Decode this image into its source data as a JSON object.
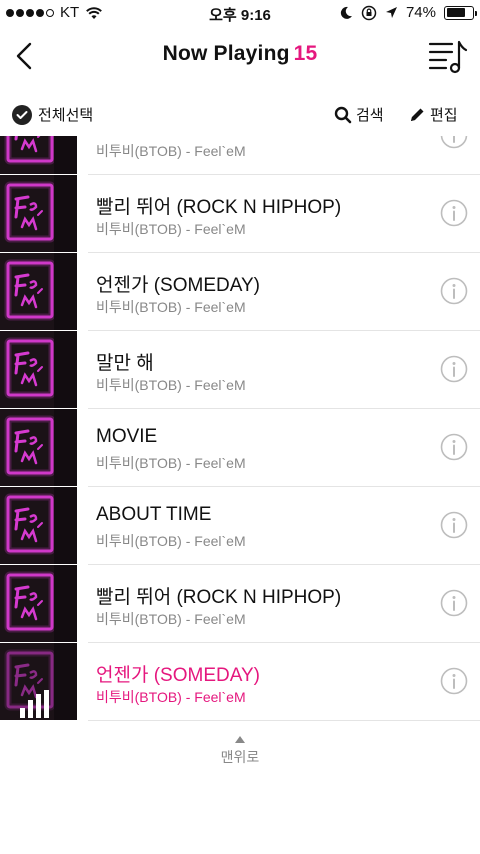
{
  "status_bar": {
    "carrier": "KT",
    "time": "오후 9:16",
    "battery_text": "74%",
    "battery_level": 0.74,
    "signal_bars_filled": 4,
    "signal_bars_total": 5
  },
  "header": {
    "title": "Now Playing",
    "count": "15"
  },
  "toolbar": {
    "select_all_label": "전체선택",
    "search_label": "검색",
    "edit_label": "편집"
  },
  "songs": [
    {
      "title": "",
      "subtitle": "비투비(BTOB) - Feel`eM",
      "playing": false
    },
    {
      "title": "빨리 뛰어 (ROCK N HIPHOP)",
      "subtitle": "비투비(BTOB) - Feel`eM",
      "playing": false
    },
    {
      "title": "언젠가 (SOMEDAY)",
      "subtitle": "비투비(BTOB) - Feel`eM",
      "playing": false
    },
    {
      "title": "말만 해",
      "subtitle": "비투비(BTOB) - Feel`eM",
      "playing": false
    },
    {
      "title": "MOVIE",
      "subtitle": "비투비(BTOB) - Feel`eM",
      "playing": false
    },
    {
      "title": "ABOUT TIME",
      "subtitle": "비투비(BTOB) - Feel`eM",
      "playing": false
    },
    {
      "title": "빨리 뛰어 (ROCK N HIPHOP)",
      "subtitle": "비투비(BTOB) - Feel`eM",
      "playing": false
    },
    {
      "title": "언젠가 (SOMEDAY)",
      "subtitle": "비투비(BTOB) - Feel`eM",
      "playing": true
    }
  ],
  "scroll_to_top_label": "맨위로",
  "colors": {
    "accent": "#e5177e",
    "text": "#111111",
    "subtext": "#888888",
    "divider": "#e4e4e4",
    "album_neon": "#d63ad0"
  },
  "icons": {
    "back": "chevron-left-icon",
    "playlist": "playlist-music-icon",
    "select_all": "check-circle-icon",
    "search": "search-icon",
    "edit": "pencil-icon",
    "info": "info-circle-icon",
    "equalizer": "equalizer-icon",
    "scroll_top": "up-triangle-icon"
  }
}
